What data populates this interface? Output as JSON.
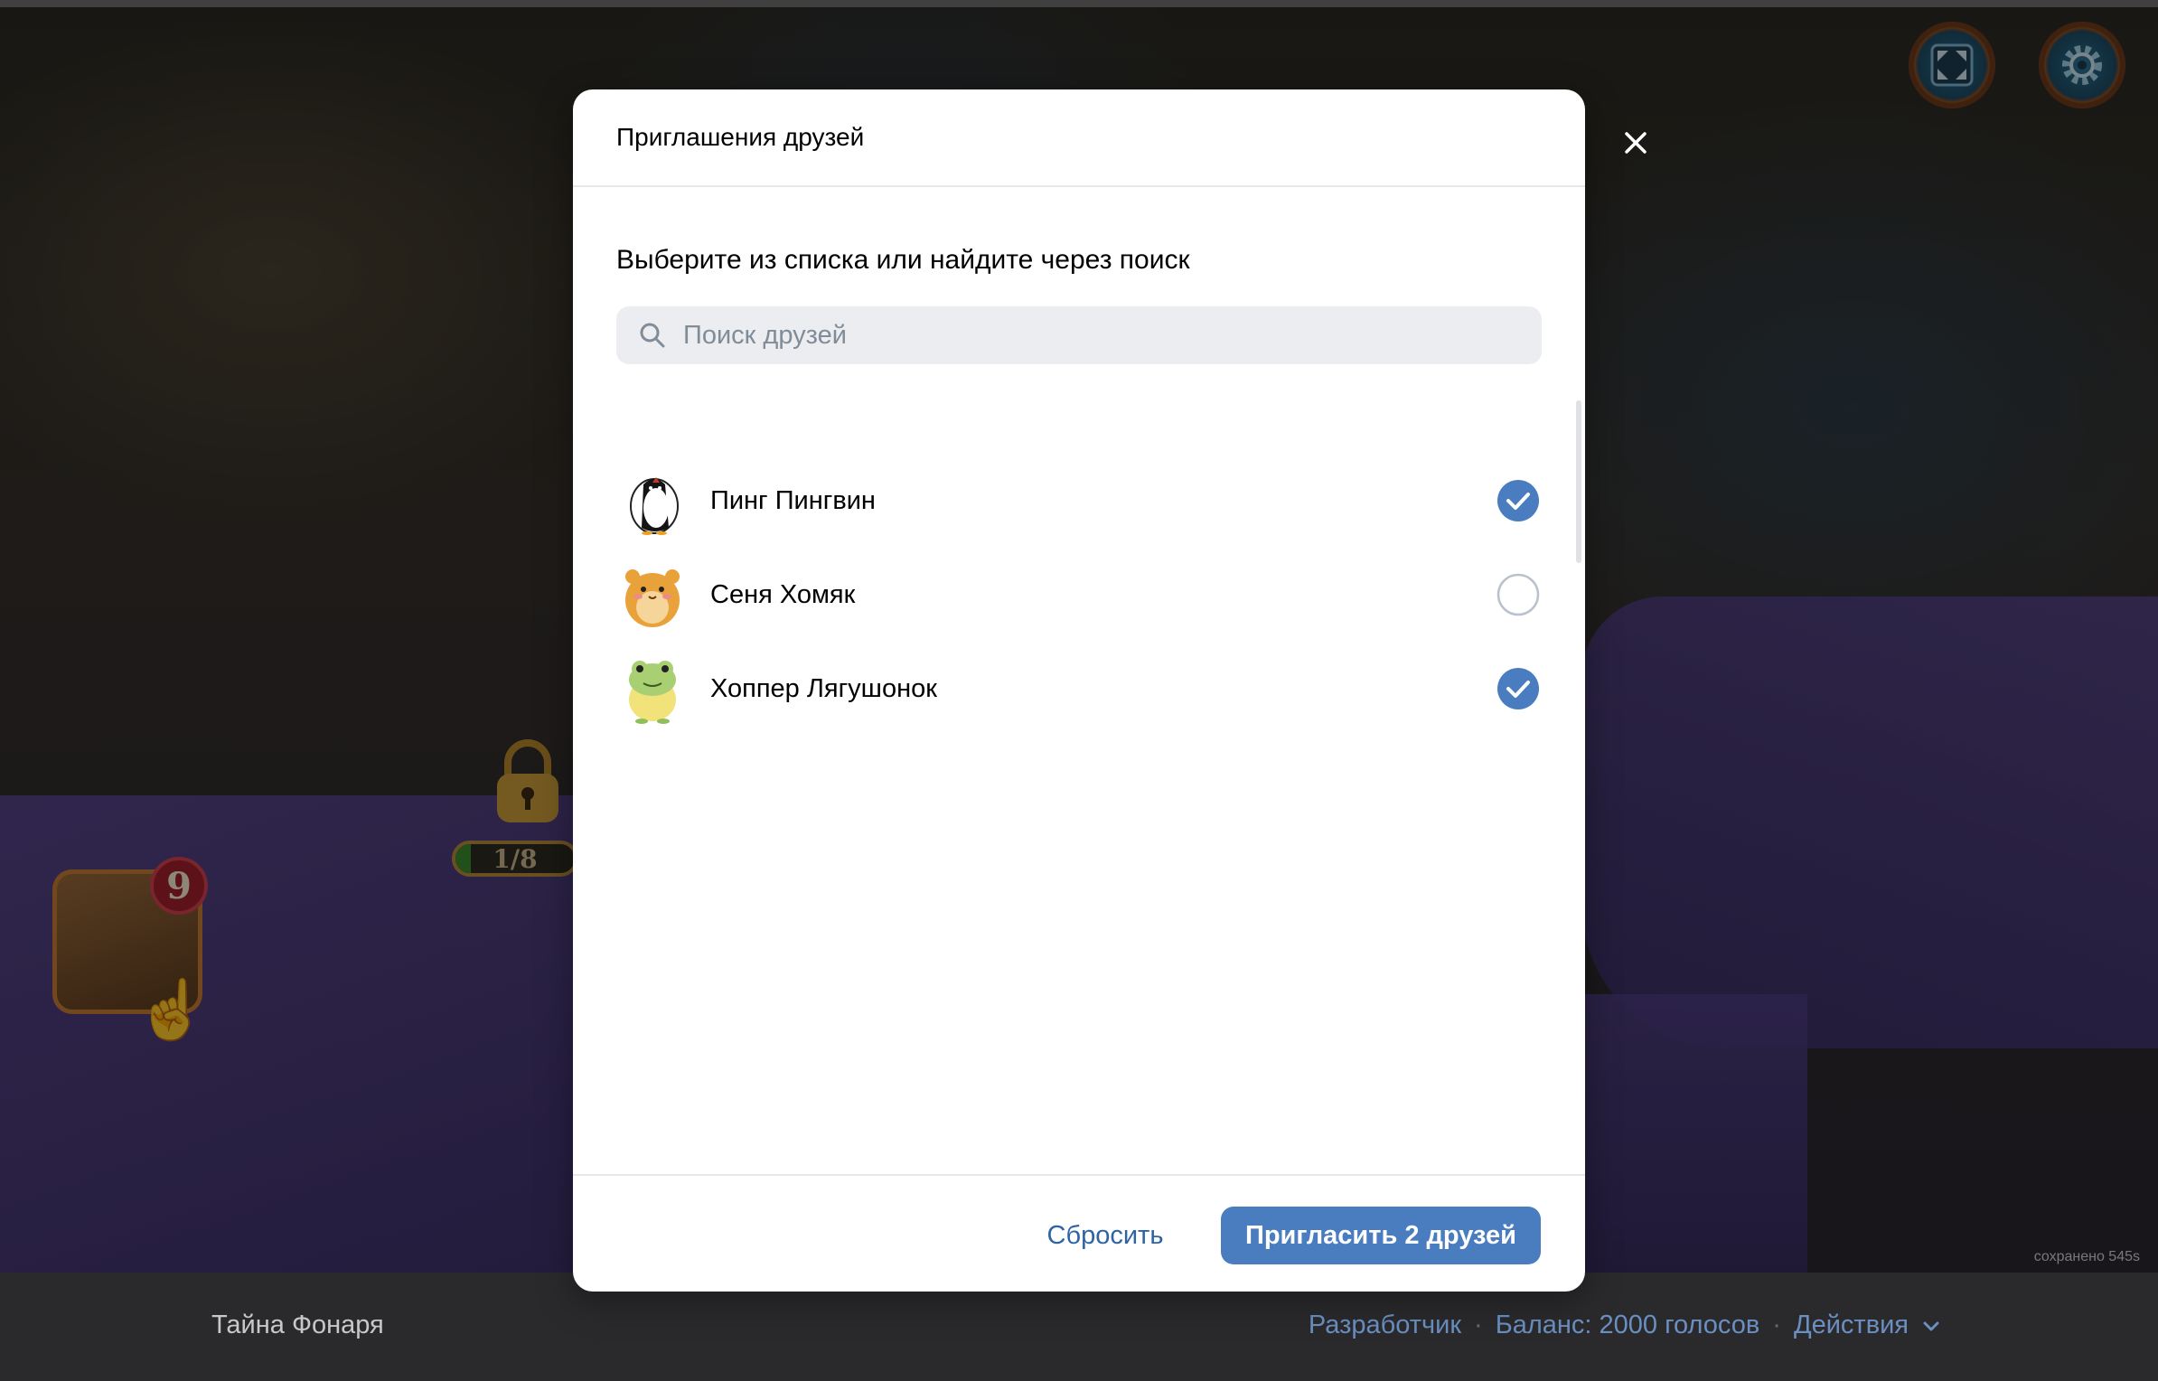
{
  "game": {
    "chest_badge": "9",
    "level_progress": "1/8",
    "level_progress_fraction": 0.125,
    "saved_text": "сохранено 545s",
    "icons": [
      "fullscreen-icon",
      "gear-icon",
      "lock-icon",
      "pointer-hand-icon"
    ]
  },
  "footer": {
    "app_title": "Тайна Фонаря",
    "developer_link": "Разработчик",
    "balance": "Баланс: 2000 голосов",
    "actions": "Действия",
    "separator": "·"
  },
  "modal": {
    "title": "Приглашения друзей",
    "subtitle": "Выберите из списка или найдите через поиск",
    "search_placeholder": "Поиск друзей",
    "search_value": "",
    "friends": [
      {
        "name": "Пинг Пингвин",
        "avatar": "penguin",
        "selected": true
      },
      {
        "name": "Сеня Хомяк",
        "avatar": "hamster",
        "selected": false
      },
      {
        "name": "Хоппер Лягушонок",
        "avatar": "frog",
        "selected": true
      }
    ],
    "reset_label": "Сбросить",
    "invite_label": "Пригласить 2 друзей",
    "accent_color": "#4a7dbf"
  }
}
